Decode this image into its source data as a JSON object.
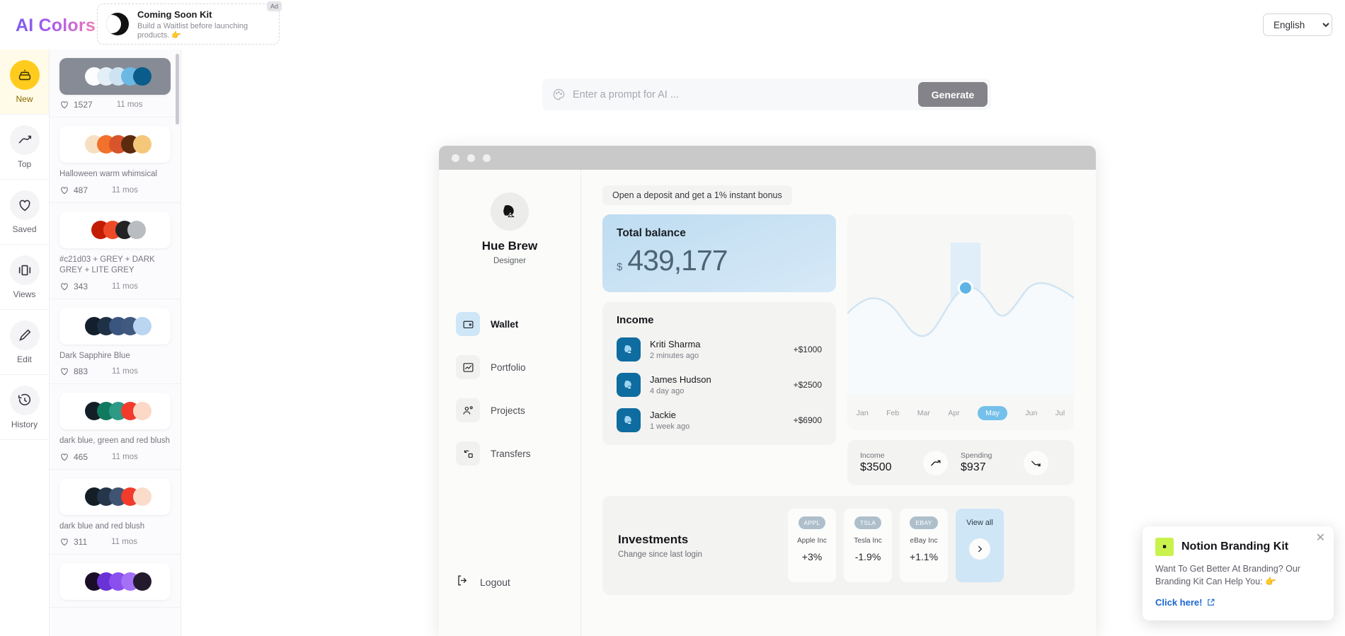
{
  "header": {
    "logo": "AI Colors",
    "ad": {
      "badge": "Ad",
      "title": "Coming Soon Kit",
      "subtitle": "Build a Waitlist before launching products. 👉",
      "logo_icon": "moon-logo-icon"
    },
    "language": {
      "selected": "English",
      "options": [
        "English"
      ],
      "icon": "chevron-down-icon"
    }
  },
  "rail": {
    "items": [
      {
        "label": "New",
        "icon": "cake-icon",
        "active": true
      },
      {
        "label": "Top",
        "icon": "trending-up-icon",
        "active": false
      },
      {
        "label": "Saved",
        "icon": "heart-icon",
        "active": false
      },
      {
        "label": "Views",
        "icon": "carousel-icon",
        "active": false
      },
      {
        "label": "Edit",
        "icon": "pencil-icon",
        "active": false
      },
      {
        "label": "History",
        "icon": "clock-rewind-icon",
        "active": false
      }
    ]
  },
  "palettes": [
    {
      "name": "",
      "likes": "1527",
      "age": "11 mos",
      "dark_bg": true,
      "colors": [
        "#fcfdfe",
        "#e4eef6",
        "#cde3f2",
        "#6cb8e4",
        "#0a5c8a"
      ]
    },
    {
      "name": "Halloween warm whimsical",
      "likes": "487",
      "age": "11 mos",
      "dark_bg": false,
      "colors": [
        "#f7e0c2",
        "#f2712c",
        "#d8542a",
        "#5b2b10",
        "#f5c77a"
      ]
    },
    {
      "name": "#c21d03 + GREY + DARK GREY + LITE GREY",
      "likes": "343",
      "age": "11 mos",
      "dark_bg": false,
      "colors": [
        "#c21d03",
        "#ef4a28",
        "#232326",
        "#b9bcc0"
      ]
    },
    {
      "name": "Dark Sapphire Blue",
      "likes": "883",
      "age": "11 mos",
      "dark_bg": false,
      "colors": [
        "#141f2e",
        "#1f3147",
        "#3a557f",
        "#41597f",
        "#b9d5f2"
      ]
    },
    {
      "name": "dark blue, green and red blush",
      "likes": "465",
      "age": "11 mos",
      "dark_bg": false,
      "colors": [
        "#141e26",
        "#117a5e",
        "#2d9a86",
        "#f23b2b",
        "#fbd9c6"
      ]
    },
    {
      "name": "dark blue and red blush",
      "likes": "311",
      "age": "11 mos",
      "dark_bg": false,
      "colors": [
        "#141e26",
        "#25354a",
        "#3f5473",
        "#f23b2b",
        "#fbdccb"
      ]
    },
    {
      "name": "",
      "likes": "",
      "age": "",
      "dark_bg": false,
      "colors": [
        "#1a0d26",
        "#6a33d6",
        "#8b4ff0",
        "#a470f5",
        "#241a2e"
      ]
    }
  ],
  "prompt": {
    "placeholder": "Enter a prompt for AI ...",
    "value": "",
    "icon": "palette-icon",
    "generate_label": "Generate"
  },
  "mock": {
    "window_dots": 3,
    "user": {
      "name": "Hue Brew",
      "role": "Designer",
      "avatar_icon": "bird-avatar-icon"
    },
    "nav": [
      {
        "label": "Wallet",
        "icon": "wallet-icon",
        "active": true
      },
      {
        "label": "Portfolio",
        "icon": "chart-line-icon",
        "active": false
      },
      {
        "label": "Projects",
        "icon": "users-gear-icon",
        "active": false
      },
      {
        "label": "Transfers",
        "icon": "transfer-icon",
        "active": false
      }
    ],
    "logout": {
      "label": "Logout",
      "icon": "logout-icon"
    },
    "bonus_banner": "Open a deposit and get a 1% instant bonus",
    "balance": {
      "title": "Total balance",
      "currency": "$",
      "value": "439,177"
    },
    "income": {
      "title": "Income",
      "rows": [
        {
          "name": "Kriti Sharma",
          "time": "2 minutes ago",
          "amount": "+$1000",
          "avatar_icon": "bird-avatar-icon"
        },
        {
          "name": "James Hudson",
          "time": "4 day ago",
          "amount": "+$2500",
          "avatar_icon": "bird-avatar-icon"
        },
        {
          "name": "Jackie",
          "time": "1 week ago",
          "amount": "+$6900",
          "avatar_icon": "bird-avatar-icon"
        }
      ]
    },
    "stats": [
      {
        "label": "Income",
        "value": "$3500",
        "icon": "trend-up-icon"
      },
      {
        "label": "Spending",
        "value": "$937",
        "icon": "trend-down-icon"
      }
    ],
    "investments": {
      "title": "Investments",
      "subtitle": "Change since last login",
      "stocks": [
        {
          "ticker": "APPL",
          "name": "Apple Inc",
          "change": "+3%"
        },
        {
          "ticker": "TSLA",
          "name": "Tesla Inc",
          "change": "-1.9%"
        },
        {
          "ticker": "EBAY",
          "name": "eBay Inc",
          "change": "+1.1%"
        }
      ],
      "view_all": {
        "label": "View all",
        "icon": "chevron-right-icon"
      }
    }
  },
  "chart_data": {
    "type": "area",
    "title": "",
    "categories": [
      "Jan",
      "Feb",
      "Mar",
      "Apr",
      "May",
      "Jun",
      "Jul"
    ],
    "values": [
      46,
      52,
      34,
      40,
      72,
      50,
      66
    ],
    "selected_category": "May",
    "highlight_value": 72,
    "xlabel": "",
    "ylabel": "",
    "ylim": [
      0,
      100
    ],
    "grid": false,
    "legend": "none",
    "line_color": "#cfe4f2",
    "fill_color": "#f1f6fa",
    "marker_color": "#5fb4e5"
  },
  "notion_popup": {
    "title": "Notion Branding Kit",
    "body": "Want To Get Better At Branding? Our Branding Kit Can Help You: 👉",
    "link": "Click here!",
    "logo_icon": "notion-kit-logo-icon",
    "close_icon": "close-icon",
    "external_icon": "external-link-icon"
  }
}
